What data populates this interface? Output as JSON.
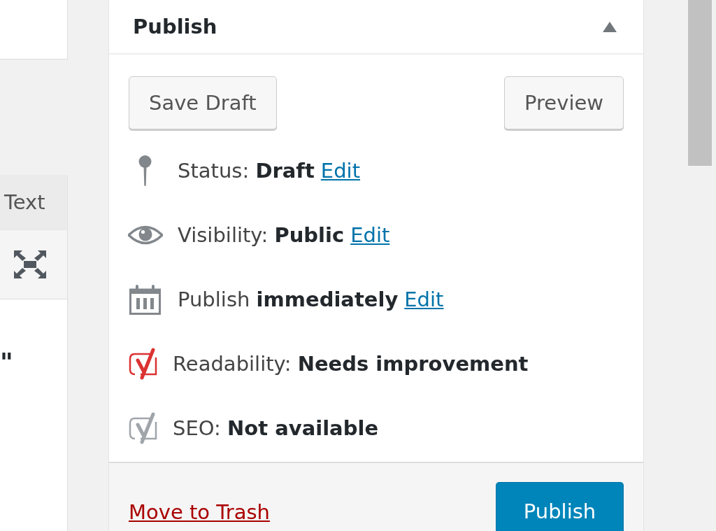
{
  "editor": {
    "tabs": [
      {
        "label": "Text",
        "selected": false
      }
    ],
    "content": "\""
  },
  "publish_box": {
    "title": "Publish",
    "expanded": true,
    "buttons": [
      {
        "label": "Save Draft"
      },
      {
        "label": "Preview"
      }
    ],
    "rows": [
      {
        "kind": "status",
        "label": "Status:",
        "value": "Draft",
        "link": "Edit"
      },
      {
        "kind": "visibility",
        "label": "Visibility:",
        "value": "Public",
        "link": "Edit"
      },
      {
        "kind": "schedule",
        "label": "Publish",
        "value": "immediately",
        "link": "Edit"
      },
      {
        "kind": "score",
        "label": "Readability:",
        "value": "Needs improvement",
        "color": "#dc3232"
      },
      {
        "kind": "score",
        "label": "SEO:",
        "value": "Not available",
        "color": "#a0a5aa"
      }
    ],
    "footer": {
      "trash_link": "Move to Trash",
      "publish_button": "Publish"
    }
  }
}
